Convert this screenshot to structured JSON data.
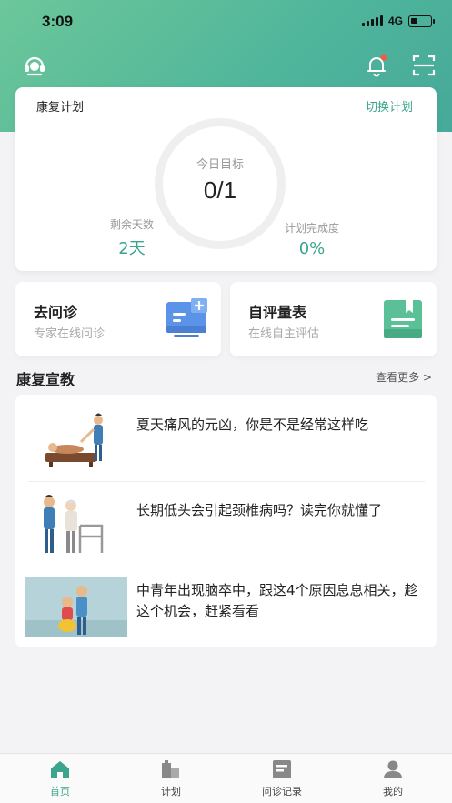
{
  "status_bar": {
    "time": "3:09",
    "network": "4G"
  },
  "plan_card": {
    "title": "康复计划",
    "switch_label": "切换计划",
    "goal_label": "今日目标",
    "goal_value": "0/1",
    "remaining_label": "剩余天数",
    "remaining_value": "2天",
    "completion_label": "计划完成度",
    "completion_value": "0%"
  },
  "quick_actions": [
    {
      "title": "去问诊",
      "subtitle": "专家在线问诊",
      "icon": "consultation-icon"
    },
    {
      "title": "自评量表",
      "subtitle": "在线自主评估",
      "icon": "assessment-book-icon"
    }
  ],
  "education": {
    "title": "康复宣教",
    "more_label": "查看更多 >",
    "articles": [
      {
        "title": "夏天痛风的元凶，你是不是经常这样吃"
      },
      {
        "title": "长期低头会引起颈椎病吗？读完你就懂了"
      },
      {
        "title": "中青年出现脑卒中，跟这4个原因息息相关，趁这个机会，赶紧看看"
      }
    ]
  },
  "tabbar": {
    "tabs": [
      {
        "label": "首页",
        "icon": "home-icon",
        "active": true
      },
      {
        "label": "计划",
        "icon": "plan-icon",
        "active": false
      },
      {
        "label": "问诊记录",
        "icon": "consult-record-icon",
        "active": false
      },
      {
        "label": "我的",
        "icon": "profile-icon",
        "active": false
      }
    ]
  },
  "colors": {
    "accent": "#3aa58c",
    "header_gradient_start": "#6cc79a",
    "header_gradient_end": "#47a99a"
  }
}
